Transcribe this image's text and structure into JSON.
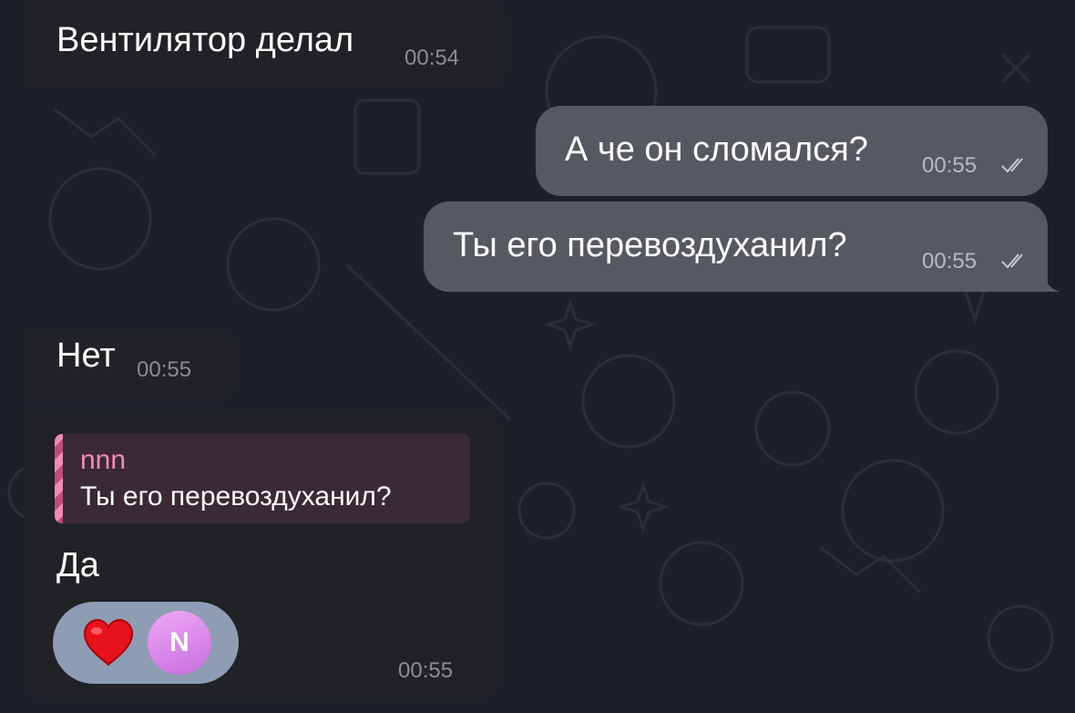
{
  "messages": [
    {
      "direction": "incoming",
      "text": "Вентилятор делал",
      "time": "00:54"
    },
    {
      "direction": "outgoing",
      "text": "А че он сломался?",
      "time": "00:55",
      "status": "read"
    },
    {
      "direction": "outgoing",
      "text": "Ты его перевоздуханил?",
      "time": "00:55",
      "status": "read"
    },
    {
      "direction": "incoming",
      "text": "Нет",
      "time": "00:55"
    },
    {
      "direction": "incoming",
      "reply_to": {
        "author": "nnn",
        "text": "Ты его перевоздуханил?"
      },
      "text": "Да",
      "time": "00:55",
      "reaction": {
        "emoji": "heart-icon",
        "reactor_initial": "N"
      }
    }
  ],
  "colors": {
    "background": "#1c2128",
    "incoming_bubble": "#212226",
    "outgoing_bubble": "#56595f",
    "reply_accent": "#f08cb4",
    "reaction_pill": "#8e9cb4"
  }
}
